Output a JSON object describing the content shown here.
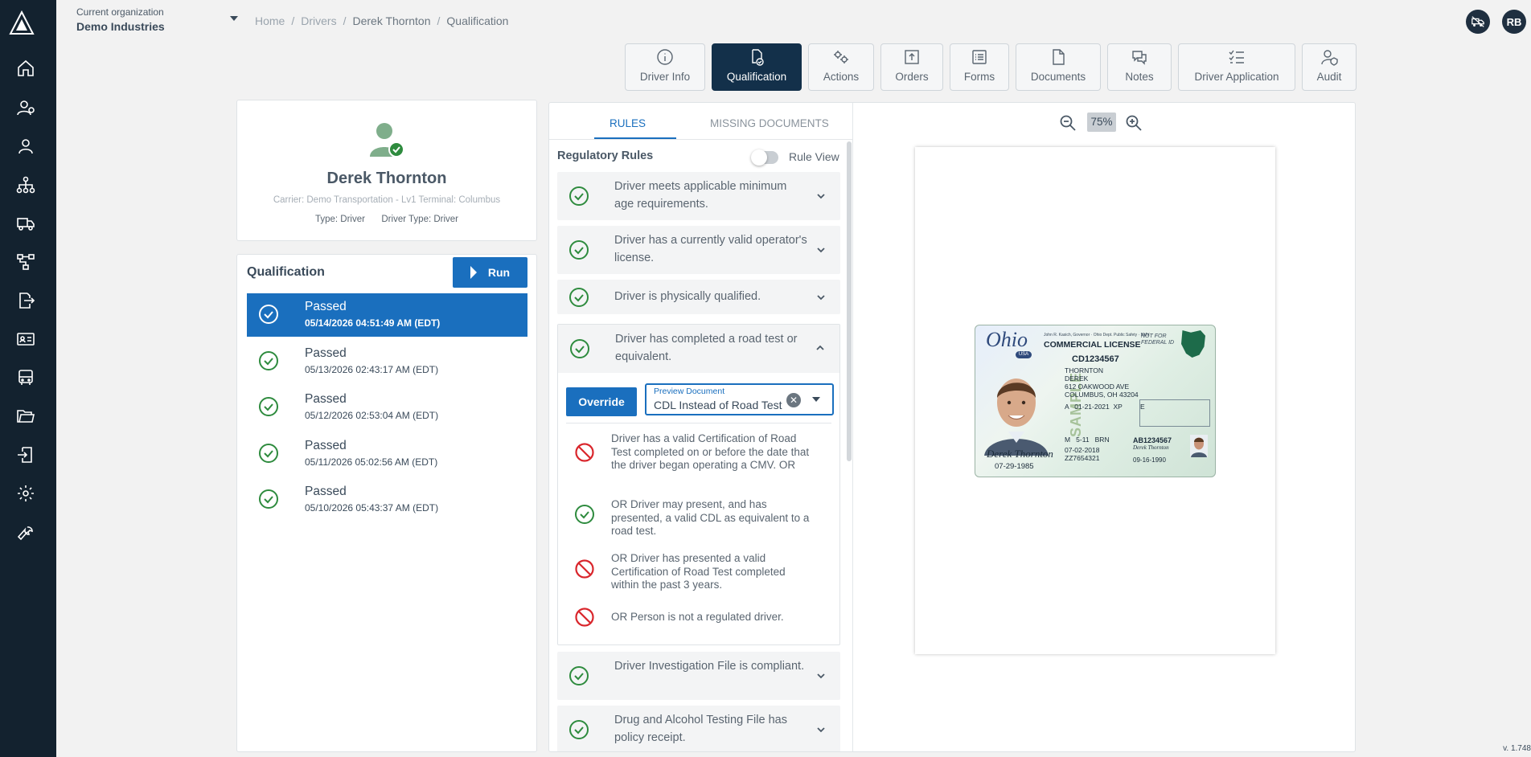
{
  "header": {
    "org_label": "Current organization",
    "org_name": "Demo Industries",
    "breadcrumb": [
      "Home",
      "Drivers",
      "Derek Thornton",
      "Qualification"
    ],
    "user_initials": "RB"
  },
  "tabs": [
    {
      "label": "Driver Info",
      "icon": "info-icon"
    },
    {
      "label": "Qualification",
      "icon": "qualification-icon"
    },
    {
      "label": "Actions",
      "icon": "gears-icon"
    },
    {
      "label": "Orders",
      "icon": "upload-box-icon"
    },
    {
      "label": "Forms",
      "icon": "list-icon"
    },
    {
      "label": "Documents",
      "icon": "document-icon"
    },
    {
      "label": "Notes",
      "icon": "chat-icon"
    },
    {
      "label": "Driver Application",
      "icon": "checklist-icon"
    },
    {
      "label": "Audit",
      "icon": "user-shield-icon"
    }
  ],
  "profile": {
    "name": "Derek Thornton",
    "carrier": "Carrier: Demo Transportation - Lv1 Terminal: Columbus",
    "type": "Type: Driver",
    "driver_type": "Driver Type: Driver"
  },
  "qualification": {
    "title": "Qualification",
    "run_label": "Run",
    "history": [
      {
        "status": "Passed",
        "timestamp": "05/14/2026 04:51:49 AM (EDT)"
      },
      {
        "status": "Passed",
        "timestamp": "05/13/2026 02:43:17 AM (EDT)"
      },
      {
        "status": "Passed",
        "timestamp": "05/12/2026 02:53:04 AM (EDT)"
      },
      {
        "status": "Passed",
        "timestamp": "05/11/2026 05:02:56 AM (EDT)"
      },
      {
        "status": "Passed",
        "timestamp": "05/10/2026 05:43:37 AM (EDT)"
      }
    ]
  },
  "rules": {
    "tab_rules": "RULES",
    "tab_missing": "MISSING DOCUMENTS",
    "section_title": "Regulatory Rules",
    "toggle_label": "Rule View",
    "items": [
      {
        "text": "Driver meets applicable minimum age requirements."
      },
      {
        "text": "Driver has a currently valid operator's license."
      },
      {
        "text": "Driver is physically qualified."
      },
      {
        "text": "Driver has completed a road test or equivalent."
      },
      {
        "text": "Driver Investigation File is compliant."
      },
      {
        "text": "Drug and Alcohol Testing File has policy receipt."
      }
    ],
    "override_label": "Override",
    "preview_label": "Preview Document",
    "preview_value": "CDL Instead of Road Test",
    "conditions": [
      {
        "status": "fail",
        "text": "Driver has a valid Certification of Road Test completed on or before the date that the driver began operating a CMV. OR"
      },
      {
        "status": "pass",
        "text": "OR Driver may present, and has presented, a valid CDL as equivalent to a road test."
      },
      {
        "status": "fail",
        "text": "OR Driver has presented a valid Certification of Road Test completed within the past 3 years."
      },
      {
        "status": "fail",
        "text": "OR Person is not a regulated driver."
      }
    ]
  },
  "viewer": {
    "zoom": "75%"
  },
  "license": {
    "state": "Ohio",
    "country": "USA",
    "title": "COMMERCIAL LICENSE",
    "gov_line": "John R. Kasich, Governor · Ohio Dept. Public Safety · BMV",
    "federal": "NOT FOR FEDERAL ID",
    "number": "CD1234567",
    "last_name": "THORNTON",
    "first_name": "DEREK",
    "address1": "612 OAKWOOD AVE",
    "address2": "COLUMBUS, OH 43204",
    "class_line": "A   01-21-2021  XP",
    "endorse": "E",
    "sample": "SAMPLE",
    "sex_line": "M   5-11   BRN",
    "issue": "07-02-2018",
    "dd": "ZZ7654321",
    "signature": "Derek Thornton",
    "dob": "07-29-1985",
    "number2": "AB1234567",
    "signature2": "Derek Thornton",
    "dob2": "09-16-1990"
  },
  "footer": {
    "version": "v. 1.748"
  },
  "colors": {
    "sidebar": "#13222f",
    "primary": "#1a6fbe",
    "active_tab": "#13304a",
    "pass": "#2e8b3e",
    "fail": "#d9262c"
  }
}
